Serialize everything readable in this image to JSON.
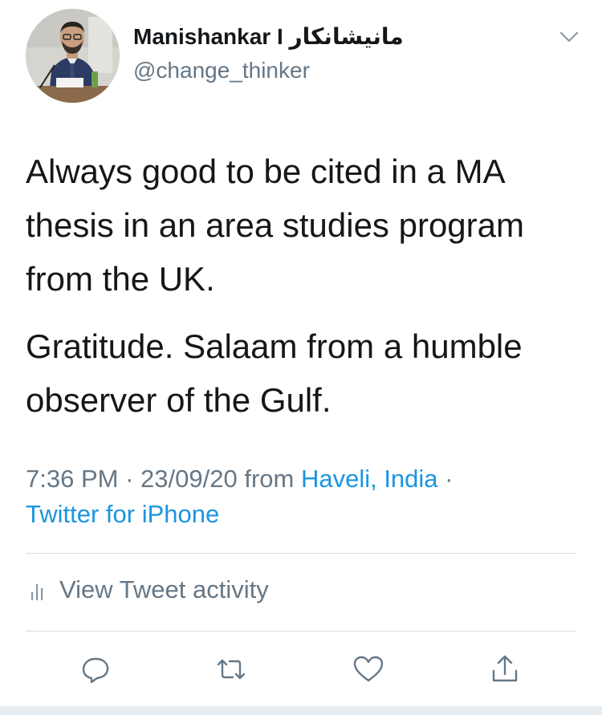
{
  "user": {
    "display_name": "Manishankar I مانیشانکار",
    "handle": "@change_thinker",
    "avatar_icon": "profile-photo"
  },
  "tweet": {
    "paragraphs": [
      "Always good to be cited in a MA thesis in an area studies program from the UK.",
      "Gratitude. Salaam from a humble observer of the Gulf."
    ],
    "time": "7:36 PM",
    "date": "23/09/20",
    "from_text": "from",
    "location": "Haveli, India",
    "separator": "·",
    "source": "Twitter for iPhone"
  },
  "activity": {
    "label": "View Tweet activity",
    "icon": "bar-chart-icon"
  },
  "actions": [
    {
      "name": "reply",
      "icon": "comment-icon"
    },
    {
      "name": "retweet",
      "icon": "retweet-icon"
    },
    {
      "name": "like",
      "icon": "heart-icon"
    },
    {
      "name": "share",
      "icon": "share-icon"
    }
  ],
  "colors": {
    "text": "#14171a",
    "secondary": "#657786",
    "link": "#1b95e0",
    "divider": "#d9dde0"
  }
}
